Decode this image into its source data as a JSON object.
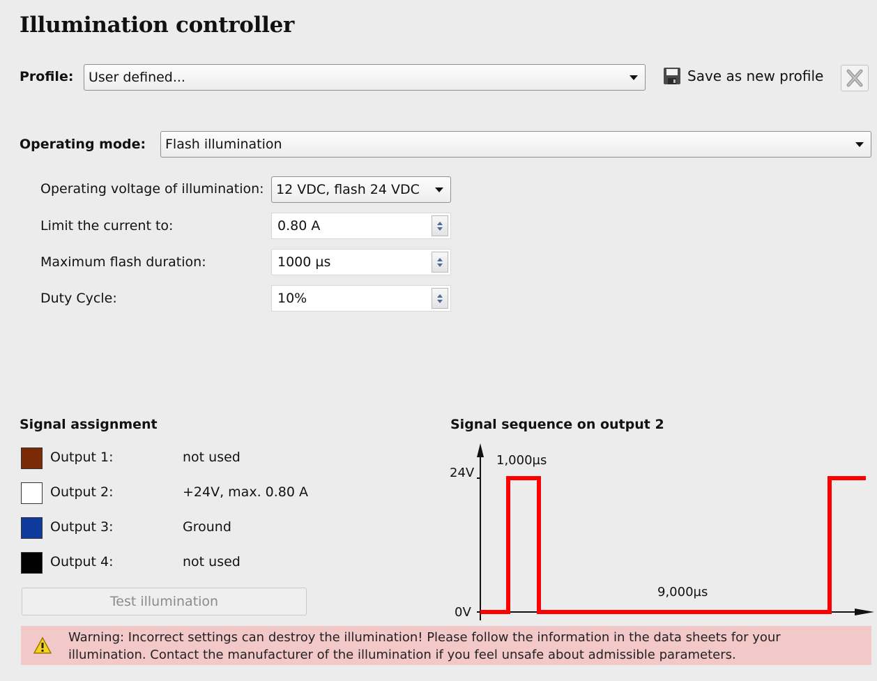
{
  "title": "Illumination controller",
  "profile": {
    "label": "Profile:",
    "value": "User defined...",
    "save_label": "Save as new profile"
  },
  "operating_mode": {
    "label": "Operating mode:",
    "value": "Flash illumination"
  },
  "settings": {
    "voltage_label": "Operating voltage of illumination:",
    "voltage_value": "12 VDC, flash 24 VDC",
    "current_label": "Limit the current to:",
    "current_value": "0.80 A",
    "flash_label": "Maximum flash duration:",
    "flash_value": "1000 µs",
    "duty_label": "Duty Cycle:",
    "duty_value": "10%"
  },
  "signal_assignment": {
    "title": "Signal assignment",
    "outputs": [
      {
        "label": "Output 1:",
        "value": "not used",
        "color": "#7a2a06"
      },
      {
        "label": "Output 2:",
        "value": "+24V, max. 0.80 A",
        "color": "#ffffff"
      },
      {
        "label": "Output 3:",
        "value": "Ground",
        "color": "#0d3a9c"
      },
      {
        "label": "Output 4:",
        "value": "not used",
        "color": "#000000"
      }
    ],
    "test_button": "Test illumination"
  },
  "signal_sequence": {
    "title": "Signal sequence on output 2",
    "y_high_label": "24V",
    "y_low_label": "0V",
    "on_duration_label": "1,000µs",
    "off_duration_label": "9,000µs",
    "line_color": "#ff0000"
  },
  "warning": {
    "line1": "Warning:  Incorrect settings can destroy the illumination! Please follow the information in the data sheets for your",
    "line2": "illumination. Contact the manufacturer of the illumination if you feel unsafe about admissible parameters."
  }
}
